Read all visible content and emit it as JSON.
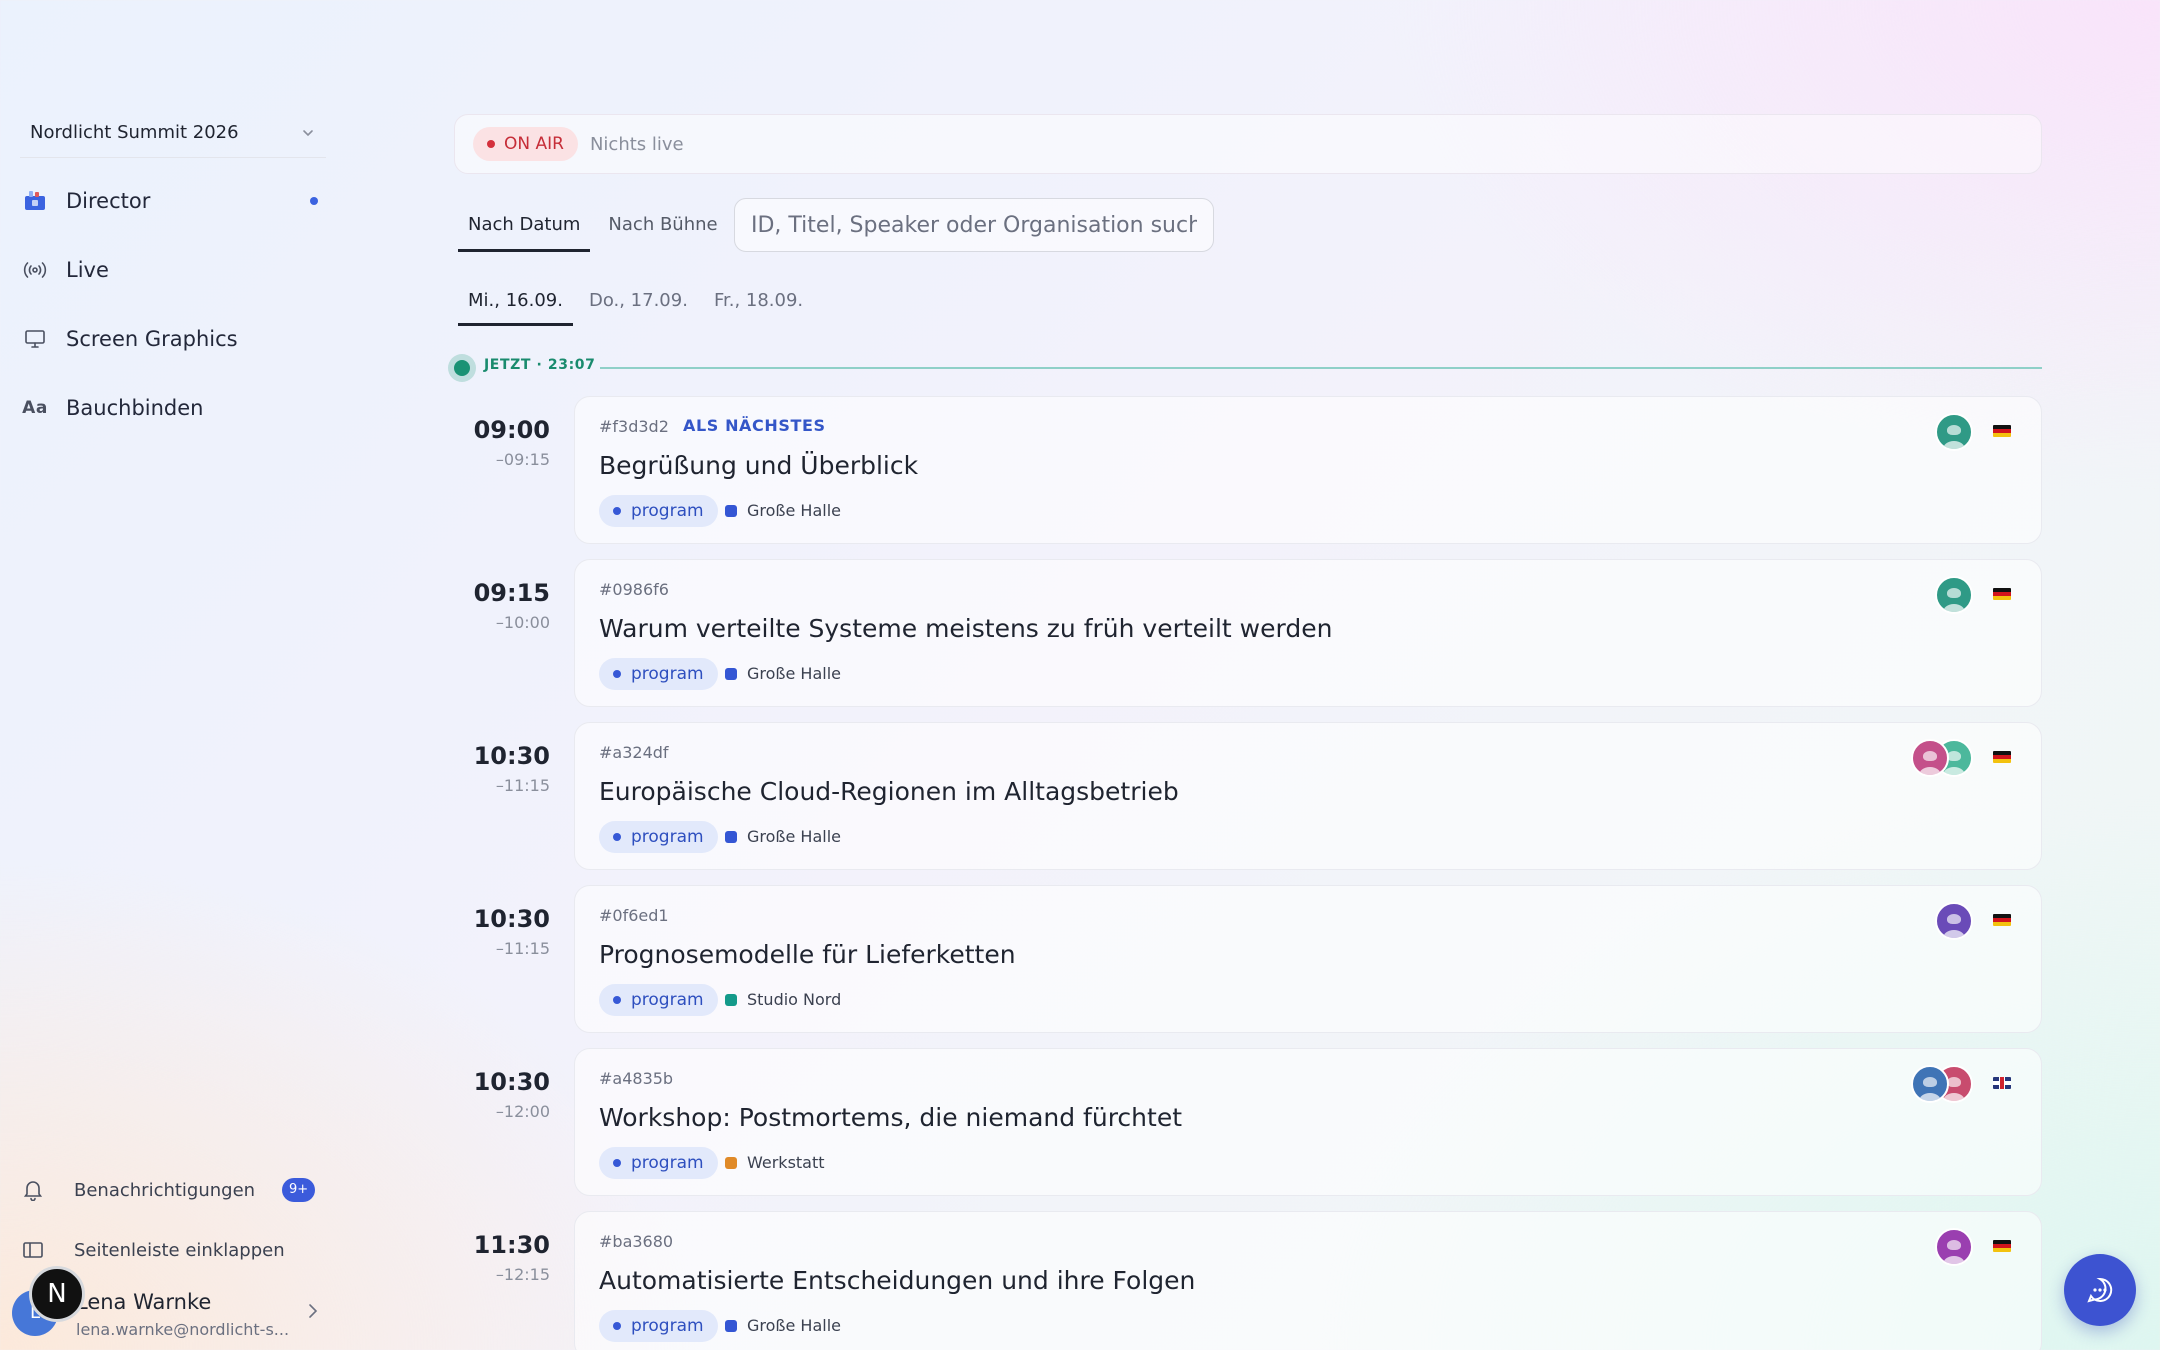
{
  "sidebar": {
    "event": "Nordlicht Summit 2026",
    "nav": [
      {
        "label": "Director",
        "icon": "director-icon",
        "active": true
      },
      {
        "label": "Live",
        "icon": "broadcast-icon"
      },
      {
        "label": "Screen Graphics",
        "icon": "monitor-icon"
      },
      {
        "label": "Bauchbinden",
        "icon": "text-aa-icon",
        "icon_text": "Aa"
      }
    ],
    "notifications_label": "Benachrichtigungen",
    "notifications_badge": "9+",
    "collapse_label": "Seitenleiste einklappen",
    "user": {
      "initial": "L",
      "name": "Lena Warnke",
      "email": "lena.warnke@nordlicht-s...",
      "logo": "N"
    }
  },
  "onair": {
    "label": "ON AIR",
    "status": "Nichts live"
  },
  "view_tabs": [
    "Nach Datum",
    "Nach Bühne"
  ],
  "search": {
    "placeholder": "ID, Titel, Speaker oder Organisation suchen"
  },
  "date_tabs": [
    "Mi., 16.09.",
    "Do., 17.09.",
    "Fr., 18.09."
  ],
  "now_marker": "JETZT · 23:07",
  "colors": {
    "accent": "#3b5bdb",
    "now": "#1a9274",
    "onair": "#d4303c",
    "room_grosse_halle": "#3456d4",
    "room_studio_nord": "#139a8a",
    "room_werkstatt": "#e08a28"
  },
  "sessions": [
    {
      "start": "09:00",
      "end": "–09:15",
      "id": "#f3d3d2",
      "next_label": "ALS NÄCHSTES",
      "title": "Begrüßung und Überblick",
      "tag": "program",
      "room": "Große Halle",
      "room_color": "#3456d4",
      "avatars": [
        "#2f9a86"
      ],
      "flag": "de"
    },
    {
      "start": "09:15",
      "end": "–10:00",
      "id": "#0986f6",
      "next_label": "",
      "title": "Warum verteilte Systeme meistens zu früh verteilt werden",
      "tag": "program",
      "room": "Große Halle",
      "room_color": "#3456d4",
      "avatars": [
        "#2f9a86"
      ],
      "flag": "de"
    },
    {
      "start": "10:30",
      "end": "–11:15",
      "id": "#a324df",
      "next_label": "",
      "title": "Europäische Cloud-Regionen im Alltagsbetrieb",
      "tag": "program",
      "room": "Große Halle",
      "room_color": "#3456d4",
      "avatars": [
        "#4cb89c",
        "#c4508a"
      ],
      "flag": "de"
    },
    {
      "start": "10:30",
      "end": "–11:15",
      "id": "#0f6ed1",
      "next_label": "",
      "title": "Prognosemodelle für Lieferketten",
      "tag": "program",
      "room": "Studio Nord",
      "room_color": "#139a8a",
      "avatars": [
        "#6a4bb8"
      ],
      "flag": "de"
    },
    {
      "start": "10:30",
      "end": "–12:00",
      "id": "#a4835b",
      "next_label": "",
      "title": "Workshop: Postmortems, die niemand fürchtet",
      "tag": "program",
      "room": "Werkstatt",
      "room_color": "#e08a28",
      "avatars": [
        "#c84c6e",
        "#3f74b6"
      ],
      "flag": "gb"
    },
    {
      "start": "11:30",
      "end": "–12:15",
      "id": "#ba3680",
      "next_label": "",
      "title": "Automatisierte Entscheidungen und ihre Folgen",
      "tag": "program",
      "room": "Große Halle",
      "room_color": "#3456d4",
      "avatars": [
        "#9a3fb0"
      ],
      "flag": "de"
    }
  ]
}
